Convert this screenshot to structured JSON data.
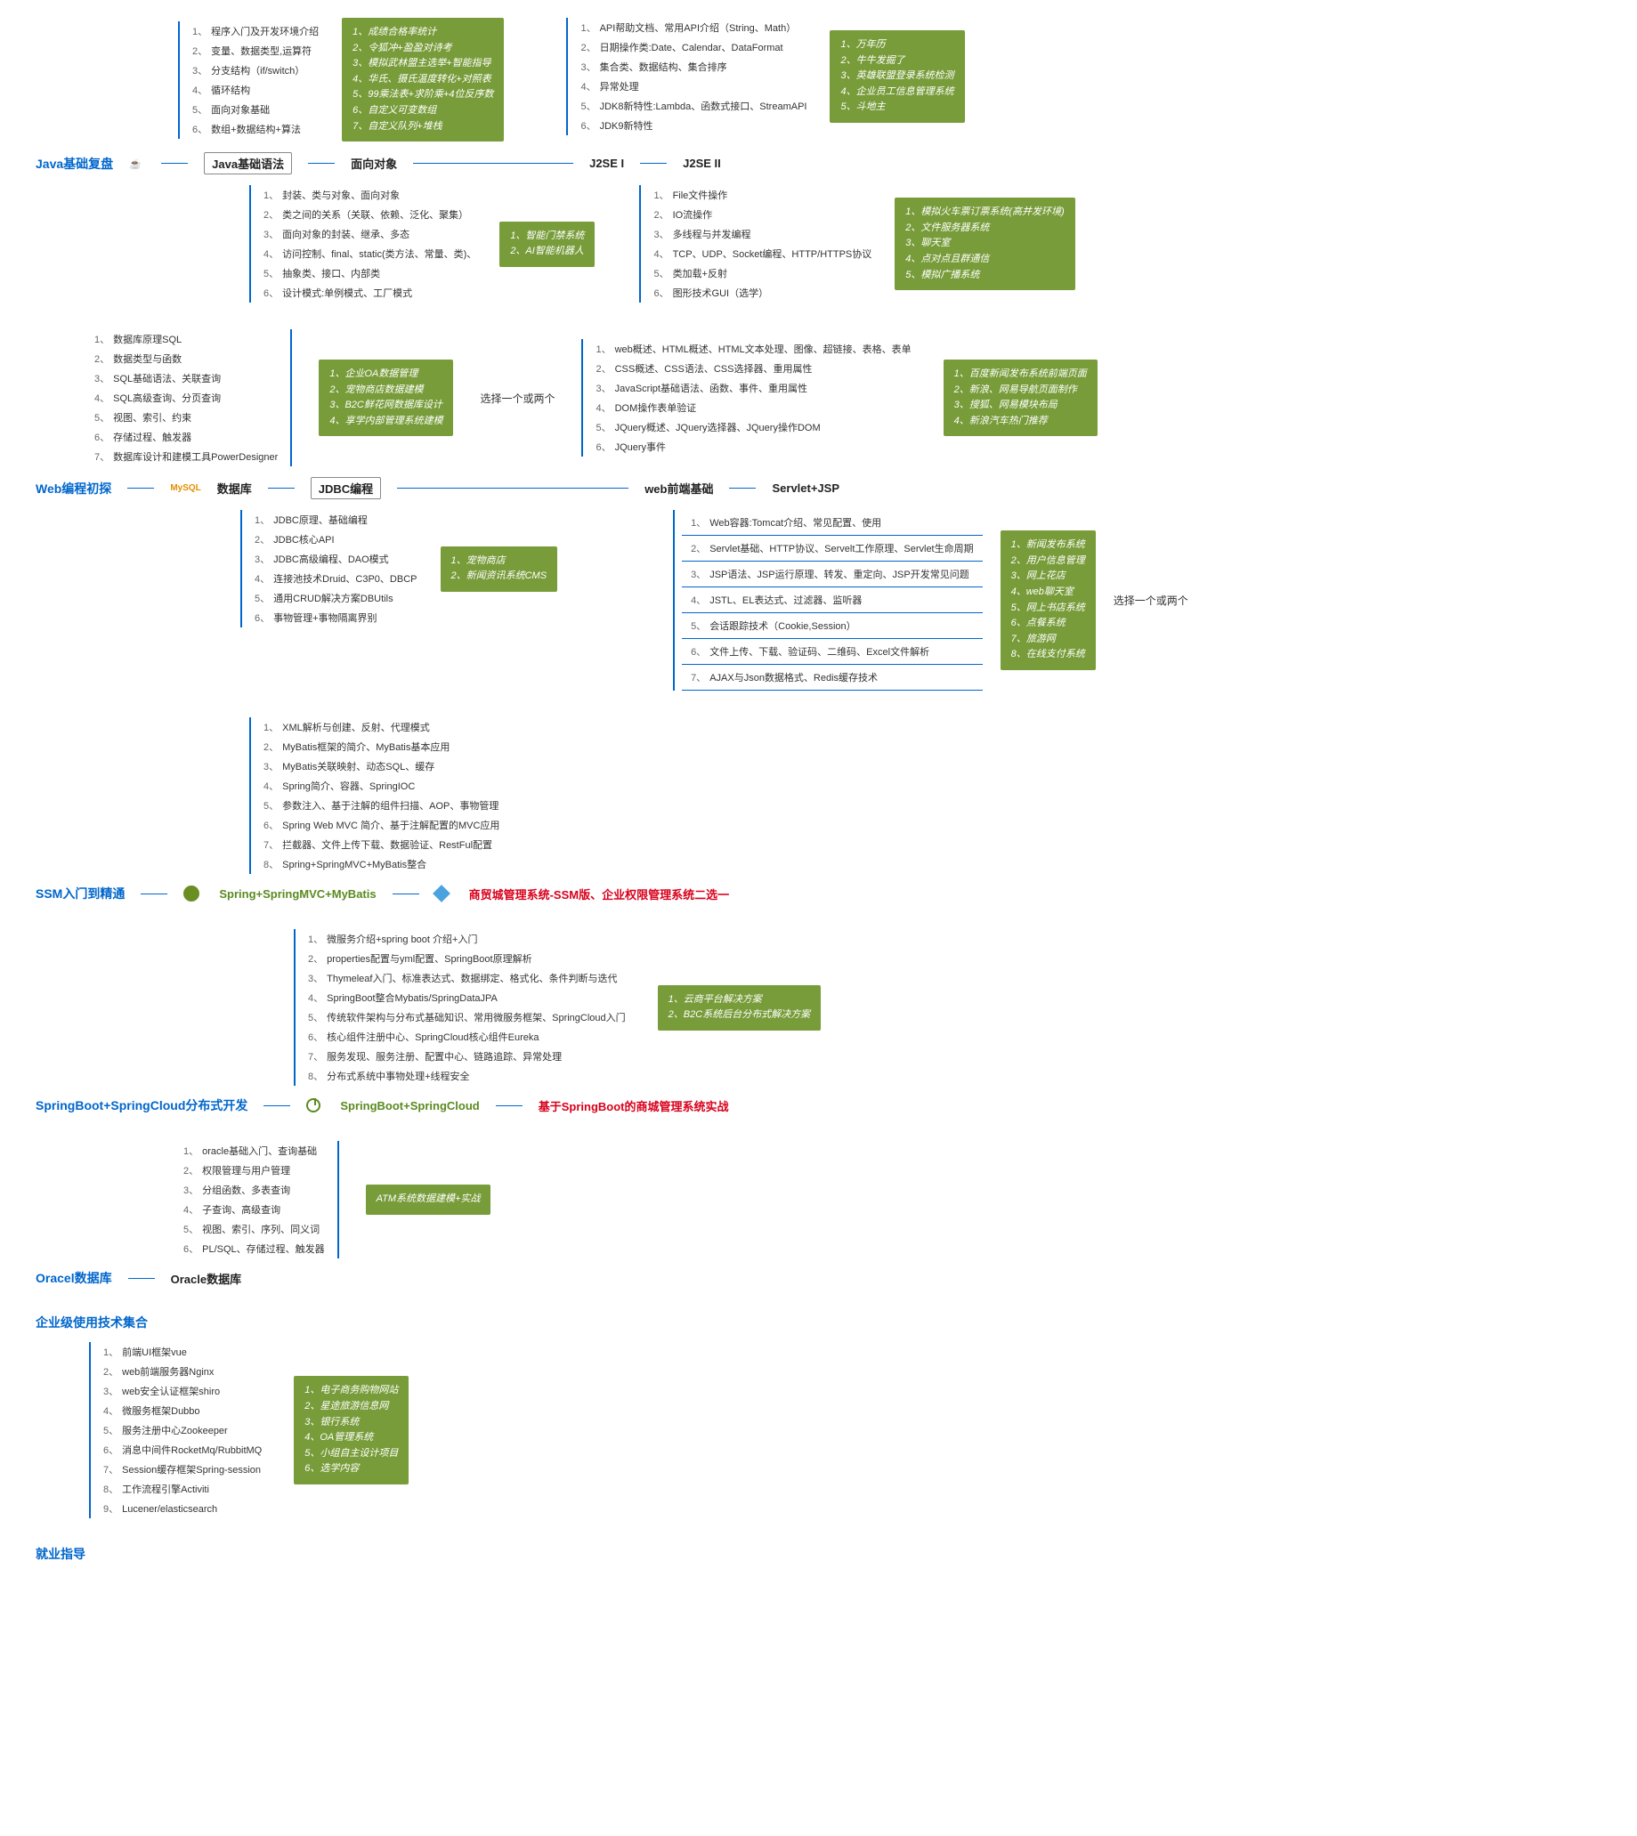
{
  "sec1": {
    "title": "Java基础复盘",
    "n1": "Java基础语法",
    "n2": "面向对象",
    "n3": "J2SE I",
    "n4": "J2SE II",
    "list_a": [
      "程序入门及开发环境介绍",
      "变量、数据类型,运算符",
      "分支结构（if/switch）",
      "循环结构",
      "面向对象基础",
      "数组+数据结构+算法"
    ],
    "green_a": [
      "成绩合格率统计",
      "令狐冲+盈盈对诗考",
      "模拟武林盟主选举+智能指导",
      "华氏、摄氏温度转化+对照表",
      "99乘法表+求阶乘+4位反序数",
      "自定义可变数组",
      "自定义队列+堆栈"
    ],
    "list_b": [
      "API帮助文档、常用API介绍（String、Math）",
      "日期操作类:Date、Calendar、DataFormat",
      "集合类、数据结构、集合排序",
      "异常处理",
      "JDK8新特性:Lambda、函数式接口、StreamAPI",
      "JDK9新特性"
    ],
    "green_b": [
      "万年历",
      "牛牛发掘了",
      "英雄联盟登录系统检测",
      "企业员工信息管理系统",
      "斗地主"
    ],
    "list_c": [
      "封装、类与对象、面向对象",
      "类之间的关系（关联、依赖、泛化、聚集）",
      "面向对象的封装、继承、多态",
      "访问控制、final、static(类方法、常量、类)、",
      "抽象类、接口、内部类",
      "设计模式:单例模式、工厂模式"
    ],
    "green_c": [
      "智能门禁系统",
      "AI智能机器人"
    ],
    "list_d": [
      "File文件操作",
      "IO流操作",
      "多线程与并发编程",
      "TCP、UDP、Socket编程、HTTP/HTTPS协议",
      "类加载+反射",
      "图形技术GUI（选学）"
    ],
    "green_d": [
      "模拟火车票订票系统(高并发环境)",
      "文件服务器系统",
      "聊天室",
      "点对点且群通信",
      "模拟广播系统"
    ]
  },
  "sec2": {
    "title": "Web编程初探",
    "mysql": "MySQL",
    "n1": "数据库",
    "n2": "JDBC编程",
    "n3": "web前端基础",
    "n4": "Servlet+JSP",
    "list_a": [
      "数据库原理SQL",
      "数据类型与函数",
      "SQL基础语法、关联查询",
      "SQL高级查询、分页查询",
      "视图、索引、约束",
      "存储过程、触发器",
      "数据库设计和建模工具PowerDesigner"
    ],
    "green_a": [
      "企业OA数据管理",
      "宠物商店数据建模",
      "B2C鲜花网数据库设计",
      "享学内部管理系统建模"
    ],
    "pick": "选择一个或两个",
    "list_b": [
      "web概述、HTML概述、HTML文本处理、图像、超链接、表格、表单",
      "CSS概述、CSS语法、CSS选择器、重用属性",
      "JavaScript基础语法、函数、事件、重用属性",
      "DOM操作表单验证",
      "JQuery概述、JQuery选择器、JQuery操作DOM",
      "JQuery事件"
    ],
    "green_b": [
      "百度新闻发布系统前端页面",
      "新浪、网易导航页面制作",
      "搜狐、网易模块布局",
      "新浪汽车热门推荐"
    ],
    "list_c": [
      "JDBC原理、基础编程",
      "JDBC核心API",
      "JDBC高级编程、DAO模式",
      "连接池技术Druid、C3P0、DBCP",
      "通用CRUD解决方案DBUtils",
      "事物管理+事物隔离界别"
    ],
    "green_c": [
      "宠物商店",
      "新闻资讯系统CMS"
    ],
    "list_d": [
      "Web容器:Tomcat介绍、常见配置、使用",
      "Servlet基础、HTTP协议、Servelt工作原理、Servlet生命周期",
      "JSP语法、JSP运行原理、转发、重定向、JSP开发常见问题",
      "JSTL、EL表达式、过滤器、监听器",
      "会话跟踪技术（Cookie,Session）",
      "文件上传、下载、验证码、二维码、Excel文件解析",
      "AJAX与Json数据格式、Redis缓存技术"
    ],
    "green_d": [
      "新闻发布系统",
      "用户信息管理",
      "网上花店",
      "web聊天室",
      "网上书店系统",
      "点餐系统",
      "旅游网",
      "在线支付系统"
    ],
    "pick2": "选择一个或两个"
  },
  "sec3": {
    "title": "SSM入门到精通",
    "n1": "Spring+SpringMVC+MyBatis",
    "n2": "商贸城管理系统-SSM版、企业权限管理系统二选一",
    "list_a": [
      "XML解析与创建、反射、代理模式",
      "MyBatis框架的简介、MyBatis基本应用",
      "MyBatis关联映射、动态SQL、缓存",
      "Spring简介、容器、SpringIOC",
      "参数注入、基于注解的组件扫描、AOP、事物管理",
      "Spring Web MVC 简介、基于注解配置的MVC应用",
      "拦截器、文件上传下载、数据验证、RestFul配置",
      "Spring+SpringMVC+MyBatis整合"
    ]
  },
  "sec4": {
    "title": "SpringBoot+SpringCloud分布式开发",
    "n1": "SpringBoot+SpringCloud",
    "n2": "基于SpringBoot的商城管理系统实战",
    "list_a": [
      "微服务介绍+spring boot 介绍+入门",
      "properties配置与yml配置、SpringBoot原理解析",
      "Thymeleaf入门、标准表达式、数据绑定、格式化、条件判断与迭代",
      "SpringBoot整合Mybatis/SpringDataJPA",
      "传统软件架构与分布式基础知识、常用微服务框架、SpringCloud入门",
      "核心组件注册中心、SpringCloud核心组件Eureka",
      "服务发现、服务注册、配置中心、链路追踪、异常处理",
      "分布式系统中事物处理+线程安全"
    ],
    "green_a": [
      "云商平台解决方案",
      "B2C系统后台分布式解决方案"
    ]
  },
  "sec5": {
    "title": "Oracel数据库",
    "n1": "Oracle数据库",
    "list_a": [
      "oracle基础入门、查询基础",
      "权限管理与用户管理",
      "分组函数、多表查询",
      "子查询、高级查询",
      "视图、索引、序列、同义词",
      "PL/SQL、存储过程、触发器"
    ],
    "green_a": "ATM系统数据建模+实战"
  },
  "sec6": {
    "title": "企业级使用技术集合",
    "list_a": [
      "前端UI框架vue",
      "web前端服务器Nginx",
      "web安全认证框架shiro",
      "微服务框架Dubbo",
      "服务注册中心Zookeeper",
      "消息中间件RocketMq/RubbitMQ",
      "Session缓存框架Spring-session",
      "工作流程引擎Activiti",
      "Lucener/elasticsearch"
    ],
    "green_a": [
      "电子商务购物网站",
      "星途旅游信息网",
      "银行系统",
      "OA管理系统",
      "小组自主设计项目",
      "选学内容"
    ]
  },
  "sec7": {
    "title": "就业指导"
  }
}
